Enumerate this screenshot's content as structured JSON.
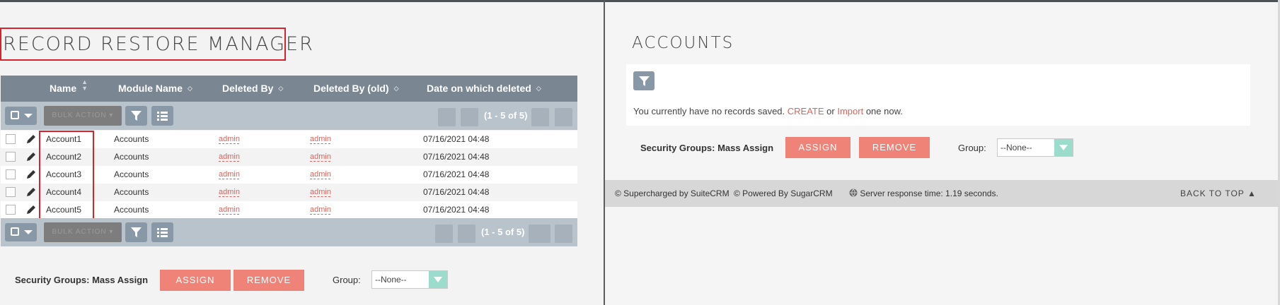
{
  "left": {
    "title": "RECORD RESTORE MANAGER",
    "columns": [
      "Name",
      "Module Name",
      "Deleted By",
      "Deleted By (old)",
      "Date on which deleted"
    ],
    "bulk_action": "BULK ACTION",
    "range": "(1 - 5 of 5)",
    "rows": [
      {
        "name": "Account1",
        "module": "Accounts",
        "deleted_by": "admin",
        "deleted_by_old": "admin",
        "date": "07/16/2021 04:48"
      },
      {
        "name": "Account2",
        "module": "Accounts",
        "deleted_by": "admin",
        "deleted_by_old": "admin",
        "date": "07/16/2021 04:48"
      },
      {
        "name": "Account3",
        "module": "Accounts",
        "deleted_by": "admin",
        "deleted_by_old": "admin",
        "date": "07/16/2021 04:48"
      },
      {
        "name": "Account4",
        "module": "Accounts",
        "deleted_by": "admin",
        "deleted_by_old": "admin",
        "date": "07/16/2021 04:48"
      },
      {
        "name": "Account5",
        "module": "Accounts",
        "deleted_by": "admin",
        "deleted_by_old": "admin",
        "date": "07/16/2021 04:48"
      }
    ],
    "mass_assign": {
      "label": "Security Groups: Mass Assign",
      "assign": "ASSIGN",
      "remove": "REMOVE",
      "group_label": "Group:",
      "group_value": "--None--"
    }
  },
  "right": {
    "title": "ACCOUNTS",
    "empty": {
      "before": "You currently have no records saved.",
      "create": "CREATE",
      "or": "or",
      "import": "Import",
      "after": "one now."
    },
    "mass_assign": {
      "label": "Security Groups: Mass Assign",
      "assign": "ASSIGN",
      "remove": "REMOVE",
      "group_label": "Group:",
      "group_value": "--None--"
    },
    "footer": {
      "suite": "© Supercharged by SuiteCRM",
      "sugar": "© Powered By SugarCRM",
      "response": "Server response time: 1.19 seconds.",
      "back_to_top": "BACK TO TOP"
    }
  },
  "colors": {
    "accent": "#f08377",
    "link": "#d9655e",
    "header": "#7a8692",
    "highlight": "#d9232c"
  },
  "icons": [
    "filter-icon",
    "column-chooser-icon",
    "pencil-icon",
    "globe-icon",
    "caret-up-icon"
  ]
}
